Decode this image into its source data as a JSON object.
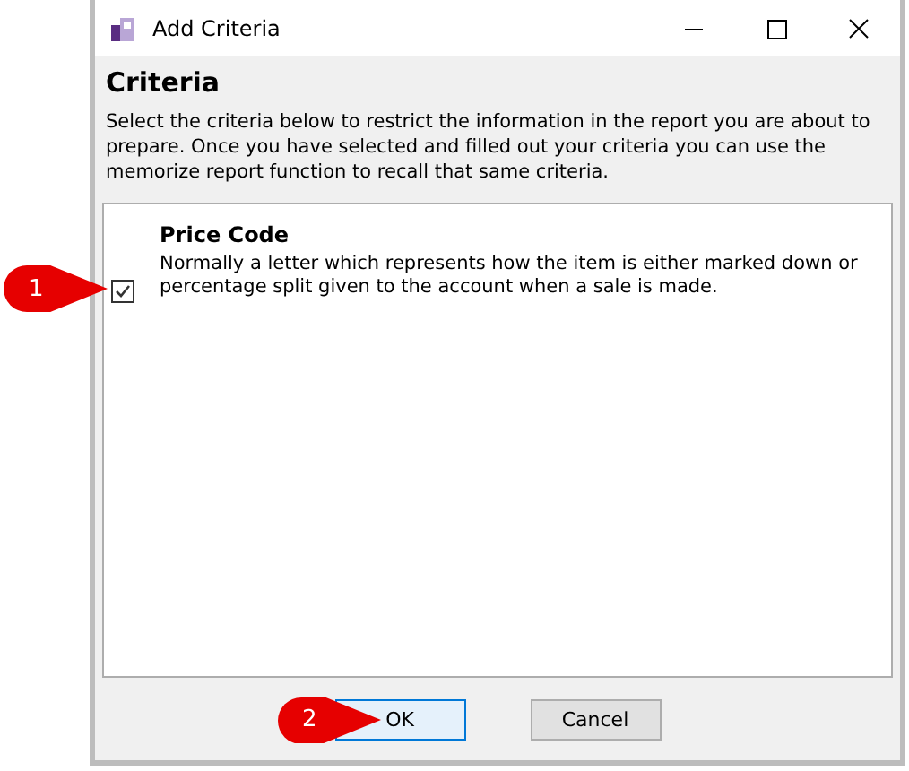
{
  "window": {
    "title": "Add Criteria"
  },
  "header": {
    "title": "Criteria",
    "description": "Select the criteria below to restrict the information in the report you are about to prepare. Once you have selected and filled out your criteria you can use the memorize report function to recall that same criteria."
  },
  "criteria": [
    {
      "name": "Price Code",
      "description": "Normally a letter which represents how the item is either marked down or percentage split given to the account when a sale is made.",
      "checked": true,
      "callout": "1"
    }
  ],
  "buttons": [
    {
      "label": "OK",
      "default": true,
      "callout": "2"
    },
    {
      "label": "Cancel",
      "default": false
    }
  ]
}
